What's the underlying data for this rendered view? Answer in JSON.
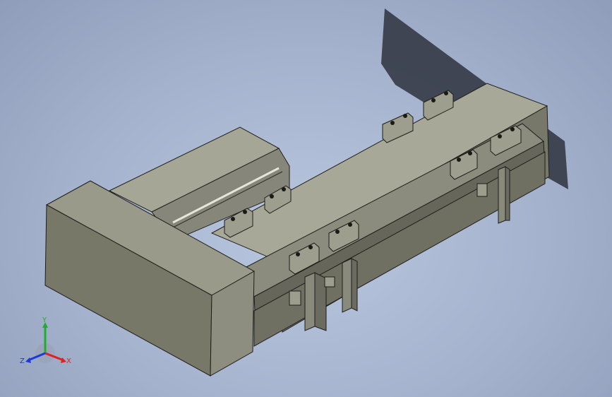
{
  "viewport": {
    "background_color": "#a9b6d1",
    "model": {
      "name": "",
      "colors": {
        "body_dark": "#6e6e62",
        "body_mid": "#8c8c7e",
        "body_light": "#a5a597",
        "edge": "#1e1e1a",
        "shadow": "#2a2f3a"
      }
    }
  },
  "triad": {
    "x_label": "X",
    "y_label": "Y",
    "z_label": "Z",
    "x_color": "#e32020",
    "y_color": "#1fae2b",
    "z_color": "#1c3ad6"
  }
}
